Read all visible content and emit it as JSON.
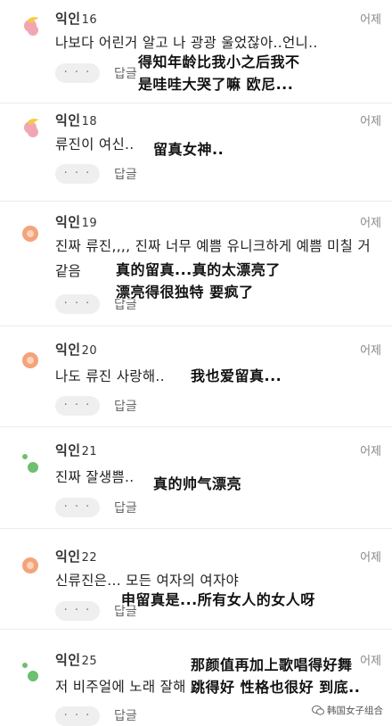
{
  "comments": [
    {
      "author": "익인",
      "num": "16",
      "time": "어제",
      "text": "나보다 어린거 알고 나 광광 울었잖아..언니..",
      "more": "· · ·",
      "reply": "답글",
      "caption": [
        "得知年龄比我小之后我不",
        "是哇哇大哭了嘛 欧尼..."
      ]
    },
    {
      "author": "익인",
      "num": "18",
      "time": "어제",
      "text": "류진이 여신..",
      "more": "· · ·",
      "reply": "답글",
      "caption": [
        "留真女神.."
      ]
    },
    {
      "author": "익인",
      "num": "19",
      "time": "어제",
      "text": "진짜 류진,,,, 진짜 너무 예쁨 유니크하게 예쁨 미칠 거 같음",
      "more": "· · ·",
      "reply": "답글",
      "caption": [
        "真的留真...真的太漂亮了",
        "漂亮得很独特 要疯了"
      ]
    },
    {
      "author": "익인",
      "num": "20",
      "time": "어제",
      "text": "나도 류진 사랑해..",
      "more": "· · ·",
      "reply": "답글",
      "caption": [
        "我也爱留真..."
      ]
    },
    {
      "author": "익인",
      "num": "21",
      "time": "어제",
      "text": "진짜 잘생쁨..",
      "more": "· · ·",
      "reply": "답글",
      "caption": [
        "真的帅气漂亮"
      ]
    },
    {
      "author": "익인",
      "num": "22",
      "time": "어제",
      "text": "신류진은... 모든 여자의 여자야",
      "more": "· · ·",
      "reply": "답글",
      "caption": [
        "申留真是...所有女人的女人呀"
      ]
    },
    {
      "author": "익인",
      "num": "25",
      "time": "어제",
      "text": "저 비주얼에 노래 잘해",
      "more": "· · ·",
      "reply": "답글",
      "caption": [
        "那颜值再加上歌唱得好舞",
        "跳得好 性格也很好 到底.."
      ]
    }
  ],
  "avatars": [
    "yellow-pink-icon",
    "yellow-pink-icon",
    "orange-circle-icon",
    "orange-circle-icon",
    "green-dots-icon",
    "orange-circle-icon",
    "green-dots-icon"
  ],
  "watermark": "韩国女子组合",
  "colors": {
    "orange": "#f4a37a",
    "yellow": "#f7c948",
    "pink": "#f2a6b3",
    "green": "#6cc070"
  }
}
